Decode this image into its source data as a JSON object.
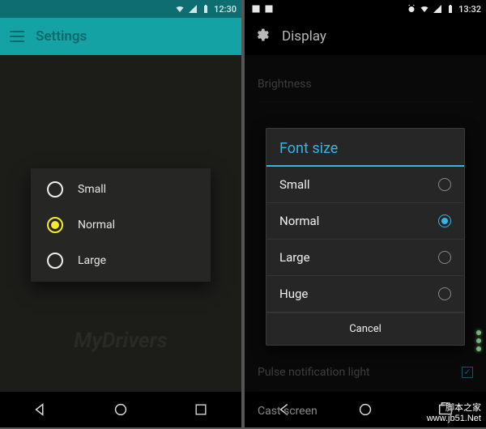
{
  "left": {
    "status": {
      "time": "12:30"
    },
    "title": "Settings",
    "options": [
      {
        "label": "Small",
        "selected": false
      },
      {
        "label": "Normal",
        "selected": true
      },
      {
        "label": "Large",
        "selected": false
      }
    ]
  },
  "right": {
    "status": {
      "time": "13:32"
    },
    "title": "Display",
    "bg": {
      "brightness": "Brightness",
      "pulse": "Pulse notification light",
      "cast": "Cast screen"
    },
    "dialog": {
      "title": "Font size",
      "options": [
        {
          "label": "Small",
          "selected": false
        },
        {
          "label": "Normal",
          "selected": true
        },
        {
          "label": "Large",
          "selected": false
        },
        {
          "label": "Huge",
          "selected": false
        }
      ],
      "cancel": "Cancel"
    }
  },
  "watermark": {
    "line1": "脚本之家",
    "line2": "www.jb51.Net",
    "mydrivers": "MyDrivers"
  }
}
